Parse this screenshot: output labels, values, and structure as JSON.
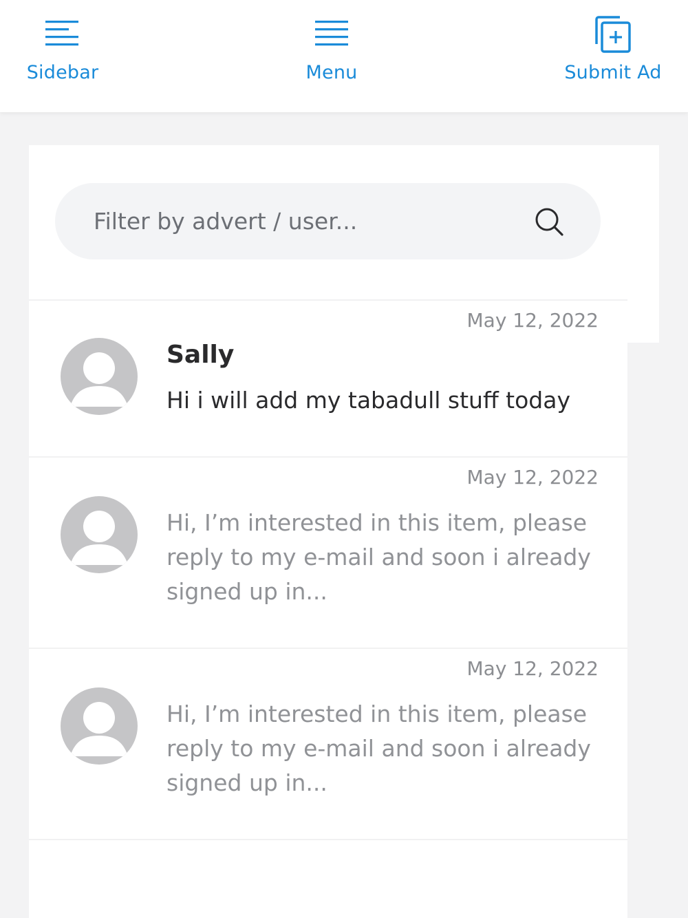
{
  "header": {
    "sidebar_label": "Sidebar",
    "menu_label": "Menu",
    "submit_label": "Submit Ad",
    "accent_color": "#1a8bd9"
  },
  "search": {
    "placeholder": "Filter by advert / user...",
    "value": "",
    "icon": "search-icon"
  },
  "conversations": [
    {
      "date": "May 12, 2022",
      "name": "Sally",
      "message": "Hi i will add my tabadull stuff today",
      "unread": true,
      "avatar": "default-user-avatar"
    },
    {
      "date": "May 12, 2022",
      "name": "",
      "message": "Hi, I’m interested in this item, please reply to my e-mail and soon i already signed up in...",
      "unread": false,
      "avatar": "default-user-avatar"
    },
    {
      "date": "May 12, 2022",
      "name": "",
      "message": "Hi, I’m interested in this item, please reply to my e-mail and soon i already signed up in...",
      "unread": false,
      "avatar": "default-user-avatar"
    }
  ]
}
